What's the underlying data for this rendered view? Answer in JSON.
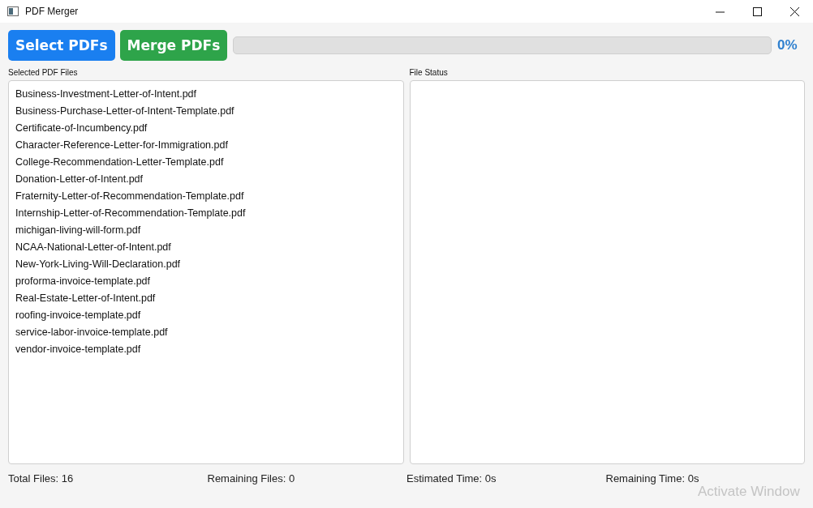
{
  "window": {
    "title": "PDF Merger"
  },
  "toolbar": {
    "buttons": [
      {
        "label": "Select PDFs",
        "kind": "select"
      },
      {
        "label": "Merge PDFs",
        "kind": "merge"
      }
    ],
    "progress": {
      "level": 0,
      "reading": "0%"
    }
  },
  "selected_files": {
    "label": "Selected PDF Files",
    "items": [
      "Business-Investment-Letter-of-Intent.pdf",
      "Business-Purchase-Letter-of-Intent-Template.pdf",
      "Certificate-of-Incumbency.pdf",
      "Character-Reference-Letter-for-Immigration.pdf",
      "College-Recommendation-Letter-Template.pdf",
      "Donation-Letter-of-Intent.pdf",
      "Fraternity-Letter-of-Recommendation-Template.pdf",
      "Internship-Letter-of-Recommendation-Template.pdf",
      "michigan-living-will-form.pdf",
      "NCAA-National-Letter-of-Intent.pdf",
      "New-York-Living-Will-Declaration.pdf",
      "proforma-invoice-template.pdf",
      "Real-Estate-Letter-of-Intent.pdf",
      "roofing-invoice-template.pdf",
      "service-labor-invoice-template.pdf",
      "vendor-invoice-template.pdf"
    ]
  },
  "file_status": {
    "label": "File Status"
  },
  "status_bar": [
    "Total Files: 16",
    "Remaining Files: 0",
    "Estimated Time: 0s",
    "Remaining Time: 0s"
  ],
  "os_overlay": {
    "text": "Activate Window"
  }
}
